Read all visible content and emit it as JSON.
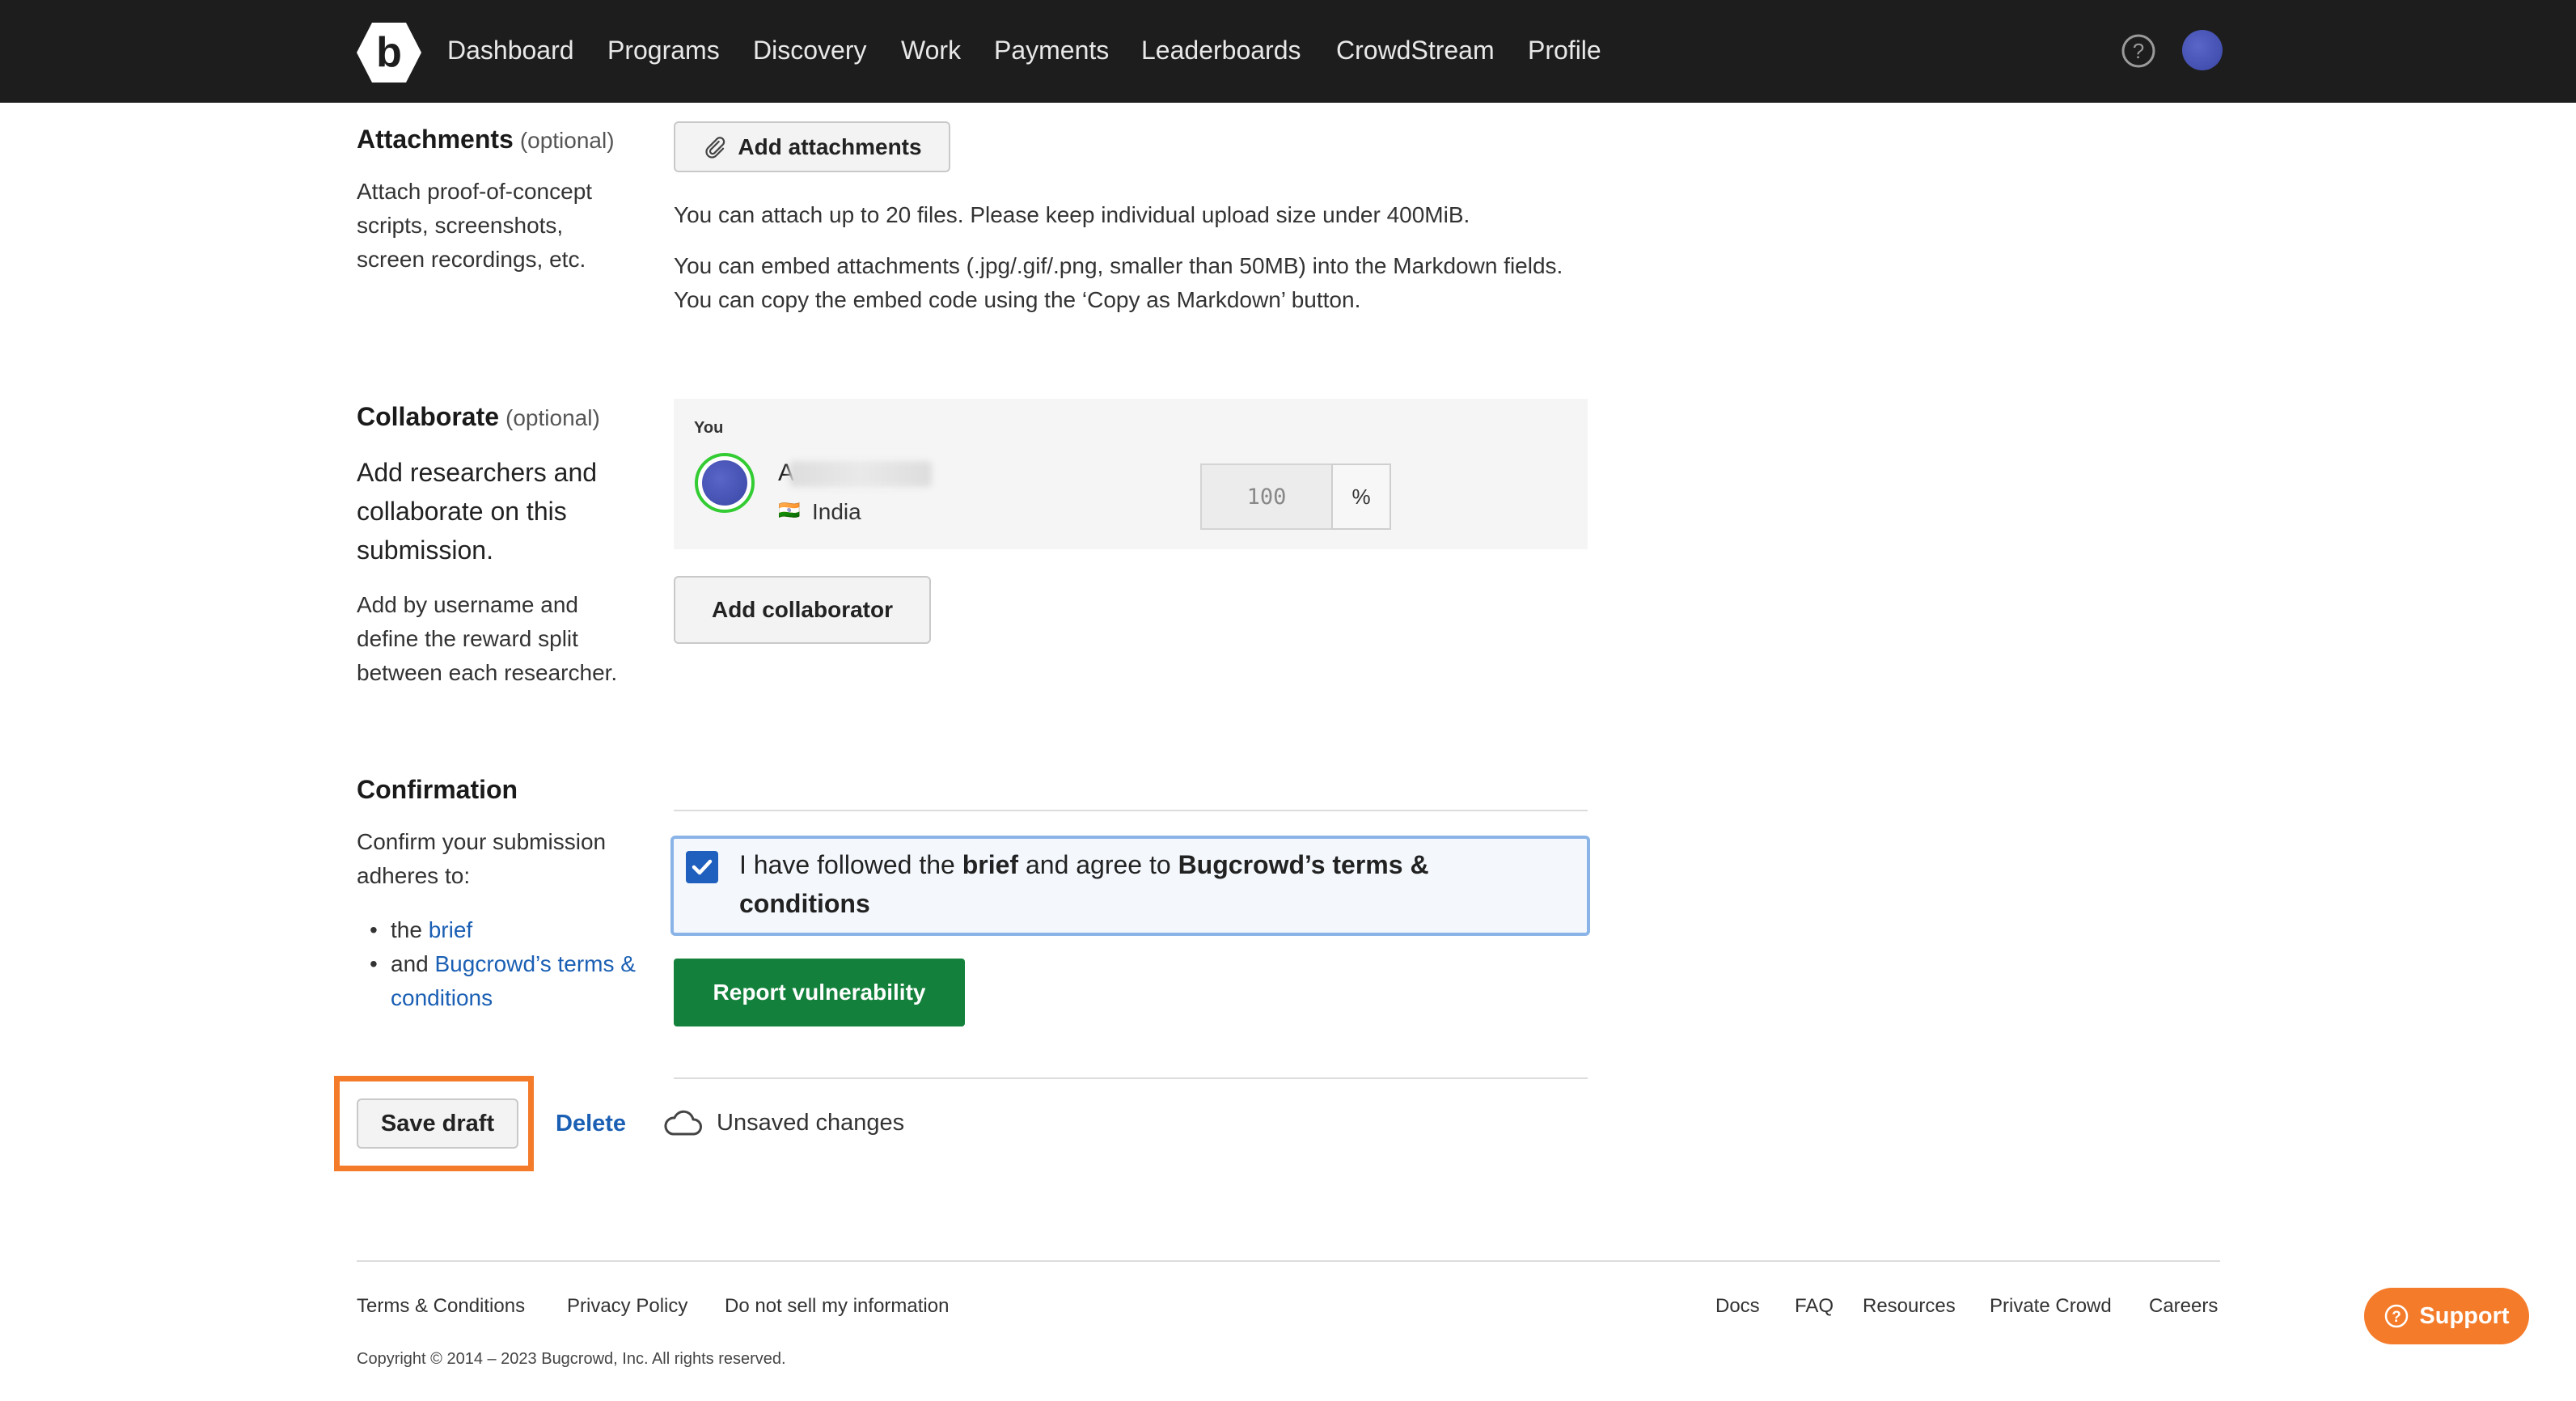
{
  "nav": {
    "items": [
      "Dashboard",
      "Programs",
      "Discovery",
      "Work",
      "Payments",
      "Leaderboards",
      "CrowdStream",
      "Profile"
    ]
  },
  "attachments": {
    "title": "Attachments",
    "optional": "(optional)",
    "description": "Attach proof-of-concept scripts, screenshots, screen recordings, etc.",
    "button": "Add attachments",
    "info1": "You can attach up to 20 files. Please keep individual upload size under 400MiB.",
    "info2": "You can embed attachments (.jpg/.gif/.png, smaller than 50MB) into the Markdown fields. You can copy the embed code using the ‘Copy as Markdown’ button."
  },
  "collaborate": {
    "title": "Collaborate",
    "optional": "(optional)",
    "description_main": "Add researchers and collaborate on this submission.",
    "description_sub": "Add by username and define the reward split between each researcher.",
    "you_label": "You",
    "username": "A",
    "country": "India",
    "flag": "🇮🇳",
    "percent_value": "100",
    "percent_suffix": "%",
    "button": "Add collaborator"
  },
  "confirmation": {
    "title": "Confirmation",
    "description": "Confirm your submission adheres to:",
    "bullet1_prefix": "the",
    "bullet1_link": "brief",
    "bullet2_prefix": "and",
    "bullet2_link": "Bugcrowd’s terms & conditions",
    "checkbox_text_1": "I have followed the",
    "checkbox_bold_1": "brief",
    "checkbox_text_2": "and agree to",
    "checkbox_bold_2": "Bugcrowd’s terms & conditions",
    "checked": true,
    "submit_button": "Report vulnerability"
  },
  "draft": {
    "save_button": "Save draft",
    "delete_link": "Delete",
    "status": "Unsaved changes"
  },
  "footer": {
    "left_links": [
      "Terms & Conditions",
      "Privacy Policy",
      "Do not sell my information"
    ],
    "right_links": [
      "Docs",
      "FAQ",
      "Resources",
      "Private Crowd",
      "Careers"
    ],
    "copyright": "Copyright © 2014 – 2023 Bugcrowd, Inc. All rights reserved."
  },
  "support": {
    "label": "Support"
  },
  "colors": {
    "nav_bg": "#1d1d1d",
    "link": "#1a5fb4",
    "primary_green": "#13813b",
    "highlight_orange": "#f47b2a",
    "checkbox_blue": "#1f5fbd"
  }
}
